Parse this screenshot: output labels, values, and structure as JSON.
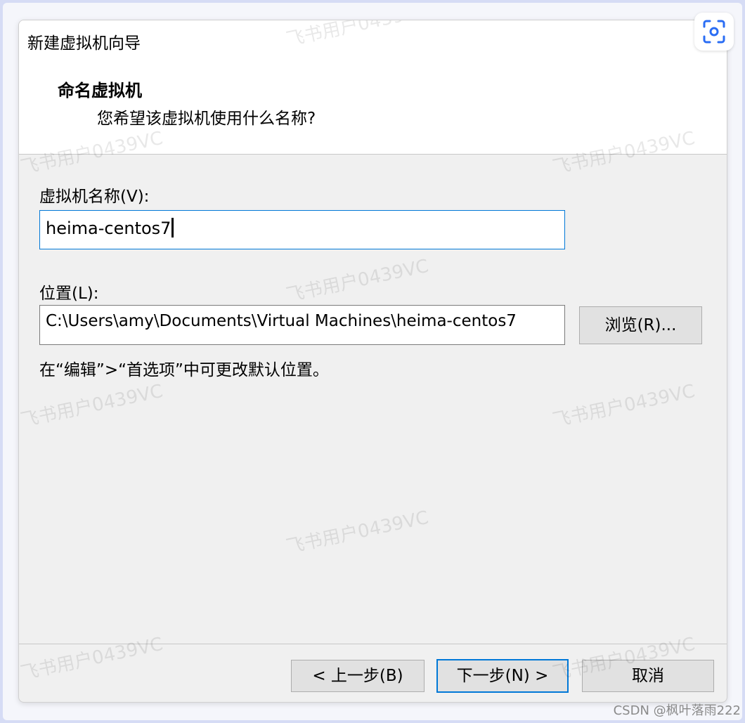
{
  "window": {
    "title": "新建虚拟机向导",
    "close_glyph": "×"
  },
  "header": {
    "title": "命名虚拟机",
    "subtitle": "您希望该虚拟机使用什么名称?"
  },
  "form": {
    "name_label": "虚拟机名称(V):",
    "name_value": "heima-centos7",
    "location_label": "位置(L):",
    "location_value": "C:\\Users\\amy\\Documents\\Virtual Machines\\heima-centos7",
    "browse_label": "浏览(R)...",
    "hint": "在“编辑”>“首选项”中可更改默认位置。"
  },
  "footer": {
    "back_label": "< 上一步(B)",
    "next_label": "下一步(N) >",
    "cancel_label": "取消"
  },
  "watermark_text": "飞书用户0439VC",
  "credit": "CSDN @枫叶落雨222",
  "colors": {
    "accent": "#0078d7",
    "dialog_bg": "#f0f0f0",
    "header_bg": "#ffffff",
    "outer_frame": "#d6dcf5"
  },
  "icons": {
    "close": "close-icon",
    "scan": "scan-icon"
  }
}
